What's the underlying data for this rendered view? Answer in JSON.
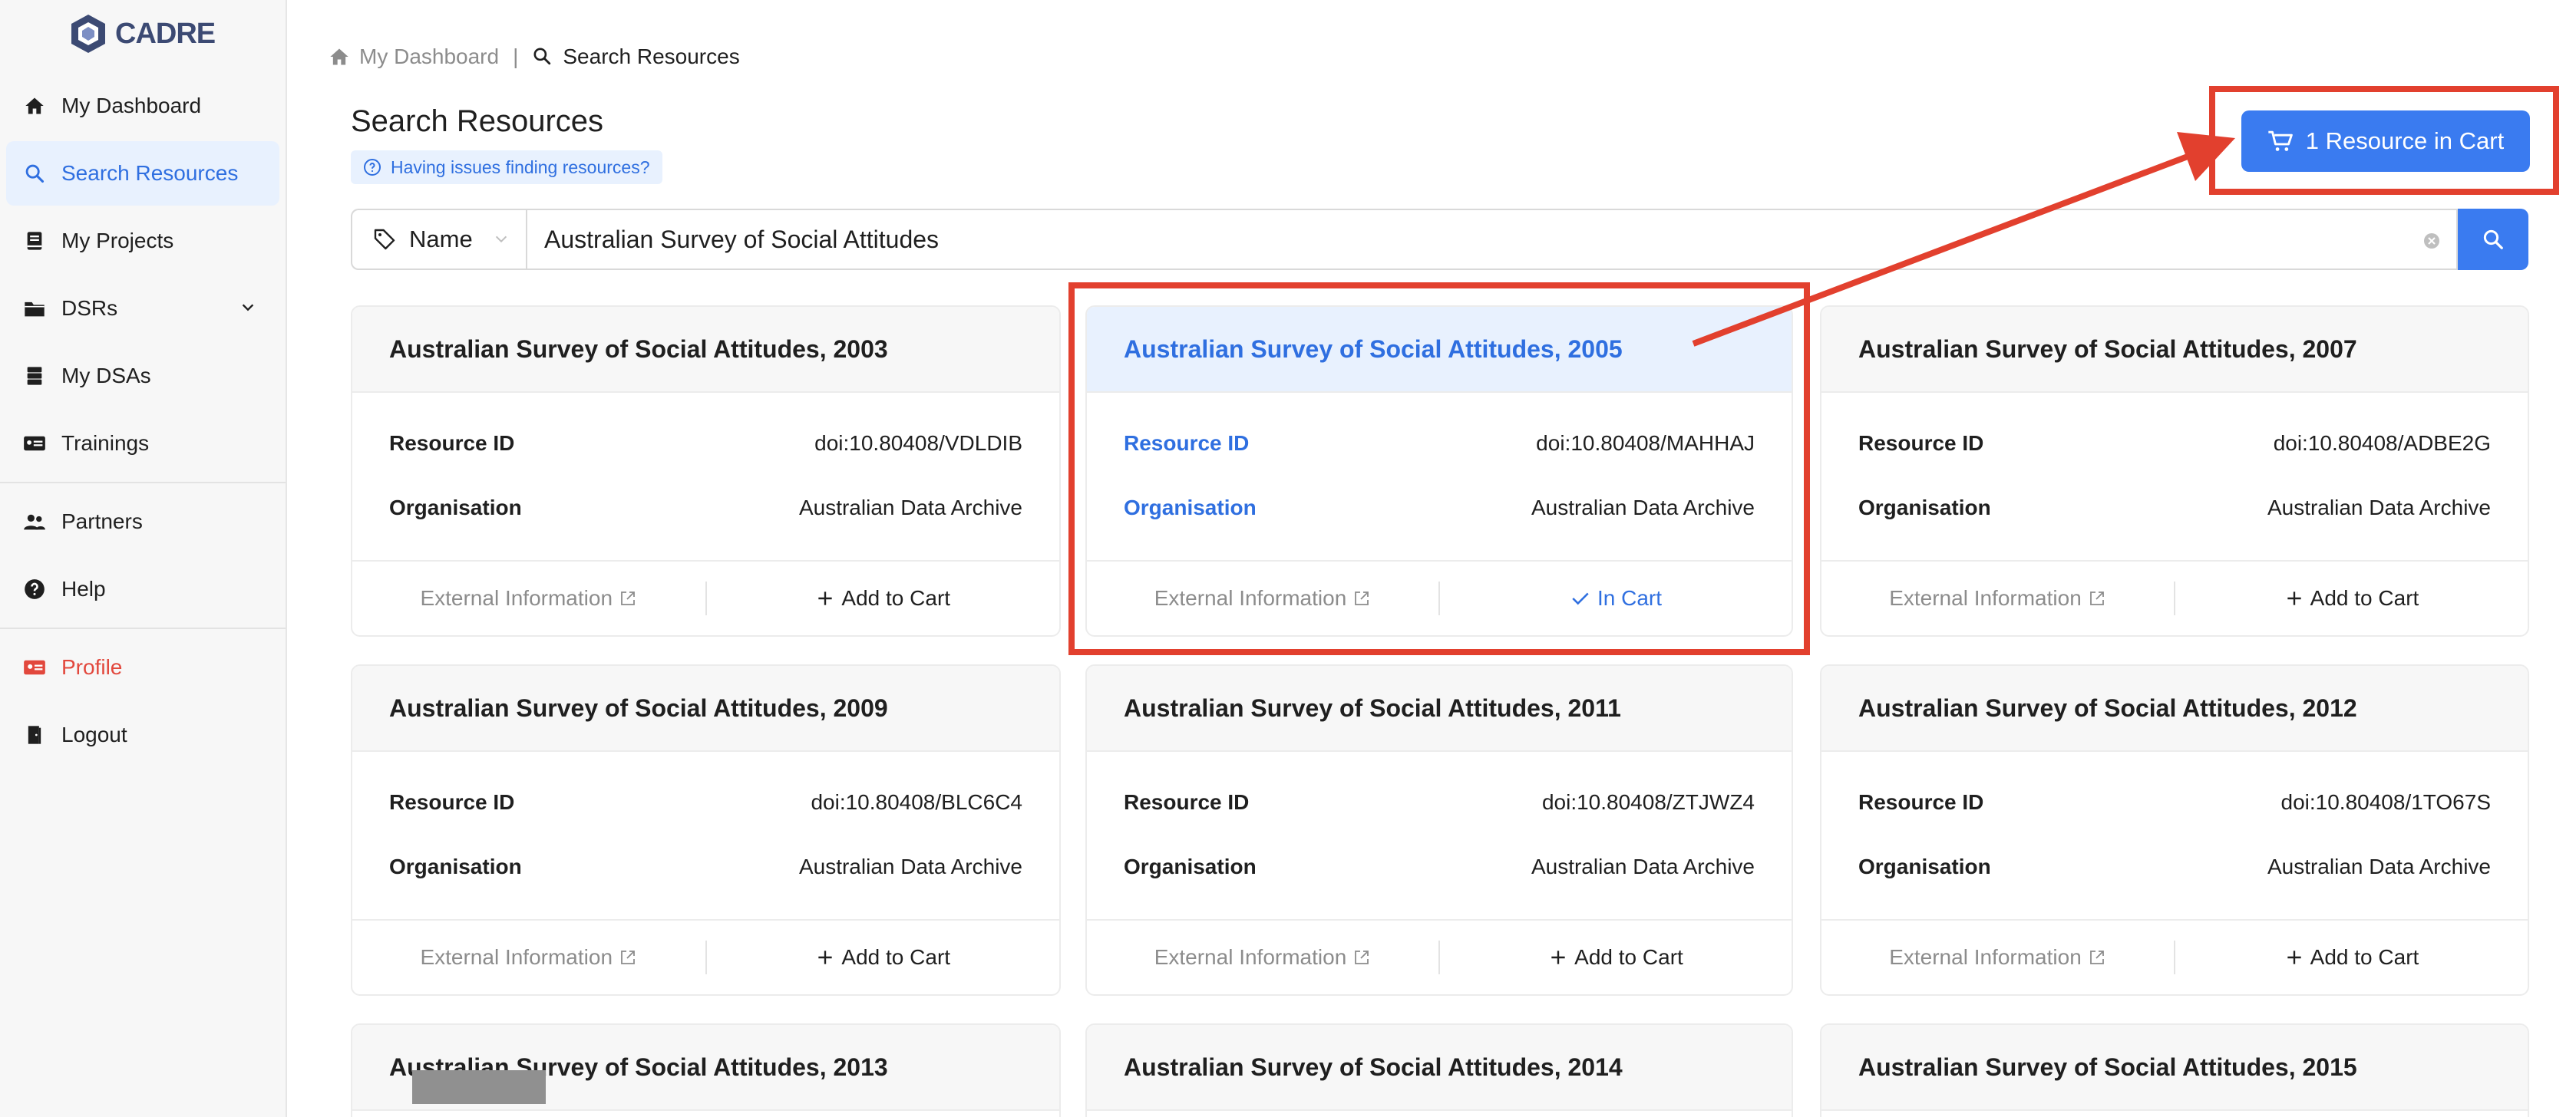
{
  "app": {
    "logo_text": "CADRE"
  },
  "sidebar": {
    "items": [
      {
        "label": "My Dashboard",
        "icon": "home-icon"
      },
      {
        "label": "Search Resources",
        "icon": "search-icon",
        "active": true
      },
      {
        "label": "My Projects",
        "icon": "book-icon"
      },
      {
        "label": "DSRs",
        "icon": "folder-icon",
        "expandable": true
      },
      {
        "label": "My DSAs",
        "icon": "database-icon"
      },
      {
        "label": "Trainings",
        "icon": "id-card-icon"
      },
      {
        "label": "Partners",
        "icon": "users-icon"
      },
      {
        "label": "Help",
        "icon": "question-icon"
      },
      {
        "label": "Profile",
        "icon": "profile-card-icon"
      },
      {
        "label": "Logout",
        "icon": "door-icon"
      }
    ]
  },
  "breadcrumb": {
    "home": "My Dashboard",
    "separator": "|",
    "current": "Search Resources"
  },
  "page": {
    "title": "Search Resources",
    "help_link": "Having issues finding resources?",
    "cart_button": "1 Resource in Cart"
  },
  "search": {
    "field_select": "Name",
    "query": "Australian Survey of Social Attitudes"
  },
  "labels": {
    "resource_id": "Resource ID",
    "organisation": "Organisation",
    "external_info": "External Information",
    "add_to_cart": "Add to Cart",
    "in_cart": "In Cart"
  },
  "cards": [
    {
      "title": "Australian Survey of Social Attitudes, 2003",
      "resource_id": "doi:10.80408/VDLDIB",
      "organisation": "Australian Data Archive",
      "in_cart": false
    },
    {
      "title": "Australian Survey of Social Attitudes, 2005",
      "resource_id": "doi:10.80408/MAHHAJ",
      "organisation": "Australian Data Archive",
      "in_cart": true
    },
    {
      "title": "Australian Survey of Social Attitudes, 2007",
      "resource_id": "doi:10.80408/ADBE2G",
      "organisation": "Australian Data Archive",
      "in_cart": false
    },
    {
      "title": "Australian Survey of Social Attitudes, 2009",
      "resource_id": "doi:10.80408/BLC6C4",
      "organisation": "Australian Data Archive",
      "in_cart": false
    },
    {
      "title": "Australian Survey of Social Attitudes, 2011",
      "resource_id": "doi:10.80408/ZTJWZ4",
      "organisation": "Australian Data Archive",
      "in_cart": false
    },
    {
      "title": "Australian Survey of Social Attitudes, 2012",
      "resource_id": "doi:10.80408/1TO67S",
      "organisation": "Australian Data Archive",
      "in_cart": false
    },
    {
      "title": "Australian Survey of Social Attitudes, 2013"
    },
    {
      "title": "Australian Survey of Social Attitudes, 2014"
    },
    {
      "title": "Australian Survey of Social Attitudes, 2015"
    }
  ],
  "colors": {
    "accent": "#3a7bf0",
    "accent_text": "#2f6fe0",
    "annotation": "#e2402e",
    "danger": "#e2483d"
  }
}
